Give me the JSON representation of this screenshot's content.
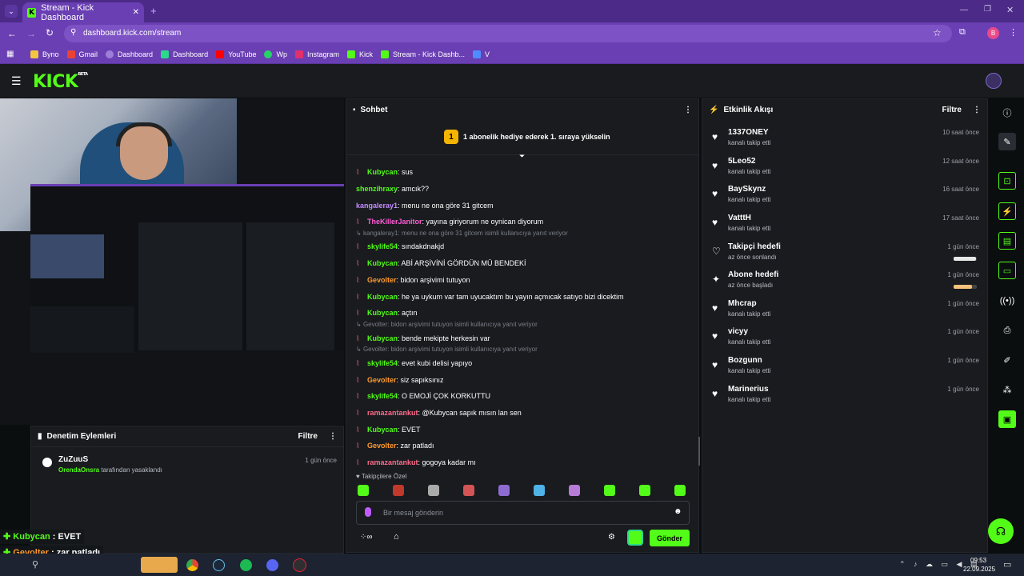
{
  "browser": {
    "tab_title": "Stream - Kick Dashboard",
    "url": "dashboard.kick.com/stream",
    "profile_initial": "B",
    "bookmarks": [
      "Byno",
      "Gmail",
      "Dashboard",
      "Dashboard",
      "YouTube",
      "Wp",
      "Instagram",
      "Kick",
      "Stream - Kick Dashb...",
      "V"
    ]
  },
  "kick": {
    "logo": "KICK",
    "beta": "BETA"
  },
  "chat": {
    "title": "Sohbet",
    "gift_count": "1",
    "gift_text": "1 abonelik hediye ederek 1. sıraya yükselin",
    "messages": [
      {
        "user": "Kubycan",
        "text": ": sus",
        "color": "#53fc18"
      },
      {
        "user": "shenzihraxy",
        "text": ": amcık??",
        "color": "#53fc18"
      },
      {
        "user": "kangaleray1",
        "text": ": menu ne ona göre 31 gitcem",
        "color": "#c38bff"
      },
      {
        "user": "TheKillerJanitor",
        "text": ": yayına giriyorum ne oynican diyorum",
        "color": "#ff5cd6"
      },
      {
        "user": "skylife54",
        "text": ": sındakdnakjd",
        "color": "#53fc18"
      },
      {
        "user": "Kubycan",
        "text": ": ABİ ARŞİVİNİ GÖRDÜN MÜ BENDEKİ",
        "color": "#53fc18"
      },
      {
        "user": "Gevolter",
        "text": ": bidon arşivimi tutuyon",
        "color": "#ff9b2e"
      },
      {
        "user": "Kubycan",
        "text": ": he ya uykum var tam uyucaktım bu yayın açmıcak satıyo bizi dicektim",
        "color": "#53fc18"
      },
      {
        "user": "Kubycan",
        "text": ": açtın",
        "color": "#53fc18"
      },
      {
        "user": "Kubycan",
        "text": ": bende mekipte herkesin var",
        "color": "#53fc18"
      },
      {
        "user": "skylife54",
        "text": ": evet kubi delisi yapıyo",
        "color": "#53fc18"
      },
      {
        "user": "Gevolter",
        "text": ": siz sapıksınız",
        "color": "#ff9b2e"
      },
      {
        "user": "skylife54",
        "text": ": O EMOJİ ÇOK KORKUTTU",
        "color": "#53fc18"
      },
      {
        "user": "ramazantankut",
        "text": ": @Kubycan sapık mısın lan sen",
        "color": "#ff6b8b"
      },
      {
        "user": "Kubycan",
        "text": ": EVET",
        "color": "#53fc18"
      },
      {
        "user": "Gevolter",
        "text": ": zar patladı",
        "color": "#ff9b2e"
      },
      {
        "user": "ramazantankut",
        "text": ": gogoya kadar mı",
        "color": "#ff6b8b"
      }
    ],
    "replies": [
      "kangaleray1: menu ne ona göre 31 gitcem isimli kullanıcıya yanıt veriyor",
      "Gevolter: bidon arşivimi tutuyon isimli kullanıcıya yanıt veriyor",
      "Gevolter: bidon arşivimi tutuyon isimli kullanıcıya yanıt veriyor"
    ],
    "emote_label": "Takipçilere Özel",
    "input_placeholder": "Bir mesaj gönderin",
    "send_label": "Gönder"
  },
  "moderation": {
    "title": "Denetim Eylemleri",
    "filter": "Filtre",
    "item_user": "ZuZuuS",
    "item_by": "OrendaOnsra",
    "item_action": " tarafından yasaklandı",
    "item_time": "1 gün önce"
  },
  "events": {
    "title": "Etkinlik Akışı",
    "filter": "Filtre",
    "items": [
      {
        "name": "1337ONEY",
        "sub": "kanalı takip etti",
        "time": "10 saat önce"
      },
      {
        "name": "5Leo52",
        "sub": "kanalı takip etti",
        "time": "12 saat önce"
      },
      {
        "name": "BaySkynz",
        "sub": "kanalı takip etti",
        "time": "16 saat önce"
      },
      {
        "name": "VatttH",
        "sub": "kanalı takip etti",
        "time": "17 saat önce"
      },
      {
        "name": "Takipçi hedefi",
        "sub": "az önce sonlandı",
        "time": "1 gün önce"
      },
      {
        "name": "Abone hedefi",
        "sub": "az önce başladı",
        "time": "1 gün önce"
      },
      {
        "name": "Mhcrap",
        "sub": "kanalı takip etti",
        "time": "1 gün önce"
      },
      {
        "name": "vicyy",
        "sub": "kanalı takip etti",
        "time": "1 gün önce"
      },
      {
        "name": "Bozgunn",
        "sub": "kanalı takip etti",
        "time": "1 gün önce"
      },
      {
        "name": "Marinerius",
        "sub": "kanalı takip etti",
        "time": "1 gün önce"
      }
    ]
  },
  "overlay": {
    "lines": [
      {
        "user": "Kubycan",
        "text": " : EVET",
        "color": "#53fc18"
      },
      {
        "user": "Gevolter",
        "text": " : zar patladı",
        "color": "#ff9b2e"
      },
      {
        "user": "ramazantankut",
        "text": " : gogoya kadar mı",
        "color": "#ff6b8b"
      }
    ]
  },
  "taskbar": {
    "time": "09:53",
    "date": "22.09.2025"
  }
}
